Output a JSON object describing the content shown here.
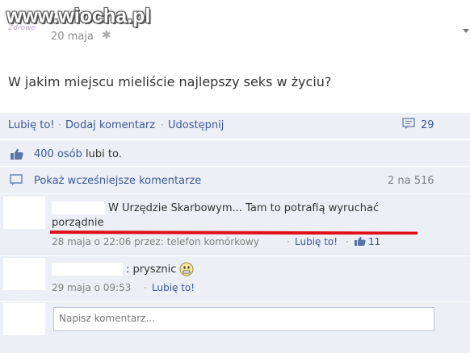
{
  "watermark": {
    "text": "www.wiocha.pl",
    "sub": "Zdrowe"
  },
  "post": {
    "date": "20 maja",
    "status": "W jakim miejscu mieliście najlepszy seks w życiu?"
  },
  "actions": {
    "like": "Lubię to!",
    "comment": "Dodaj komentarz",
    "share": "Udostępnij",
    "separator": "·",
    "comment_count": "29"
  },
  "likes": {
    "count_link": "400 osób",
    "rest": "lubi to."
  },
  "more_comments": {
    "label": "Pokaż wcześniejsze komentarze",
    "count": "2 na 516"
  },
  "comments": [
    {
      "text": "W Urzędzie Skarbowym... Tam to potrafią wyruchać",
      "text_cont": "porządnie",
      "meta": "28 maja o 22:06 przez: telefon komórkowy",
      "like": "Lubię to!",
      "like_count": "11"
    },
    {
      "text": ": prysznic",
      "meta": "29 maja o 09:53",
      "like": "Lubię to!"
    }
  ],
  "composer": {
    "placeholder": "Napisz komentarz..."
  },
  "colors": {
    "link": "#3b5998",
    "panel": "#eceff5",
    "marker": "#e0101a"
  }
}
